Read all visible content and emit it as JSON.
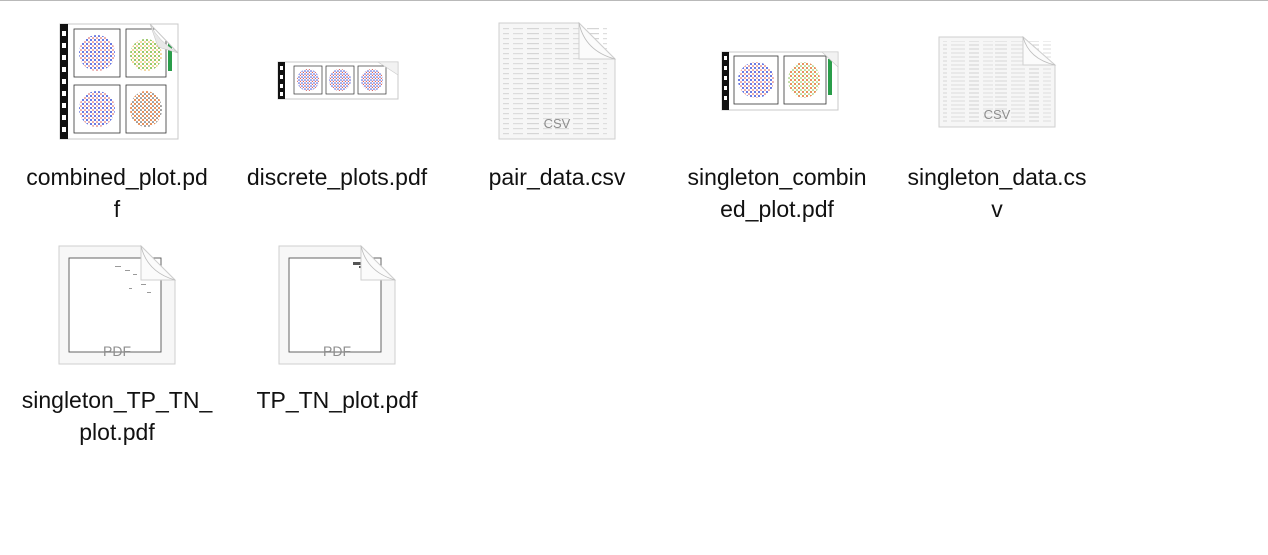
{
  "files": [
    {
      "name": "combined_plot.pdf",
      "label_lines": "combined_plot.pd\nf",
      "kind": "pdf-plot-grid"
    },
    {
      "name": "discrete_plots.pdf",
      "label_lines": "discrete_plots.pdf",
      "kind": "pdf-plot-strip"
    },
    {
      "name": "pair_data.csv",
      "label_lines": "pair_data.csv",
      "kind": "csv",
      "badge": "CSV"
    },
    {
      "name": "singleton_combined_plot.pdf",
      "label_lines": "singleton_combin\ned_plot.pdf",
      "kind": "pdf-plot-pair"
    },
    {
      "name": "singleton_data.csv",
      "label_lines": "singleton_data.cs\nv",
      "kind": "csv",
      "badge": "CSV"
    },
    {
      "name": "singleton_TP_TN_plot.pdf",
      "label_lines": "singleton_TP_TN_\nplot.pdf",
      "kind": "pdf-blank",
      "badge": "PDF"
    },
    {
      "name": "TP_TN_plot.pdf",
      "label_lines": "TP_TN_plot.pdf",
      "kind": "pdf-blank",
      "badge": "PDF"
    }
  ]
}
